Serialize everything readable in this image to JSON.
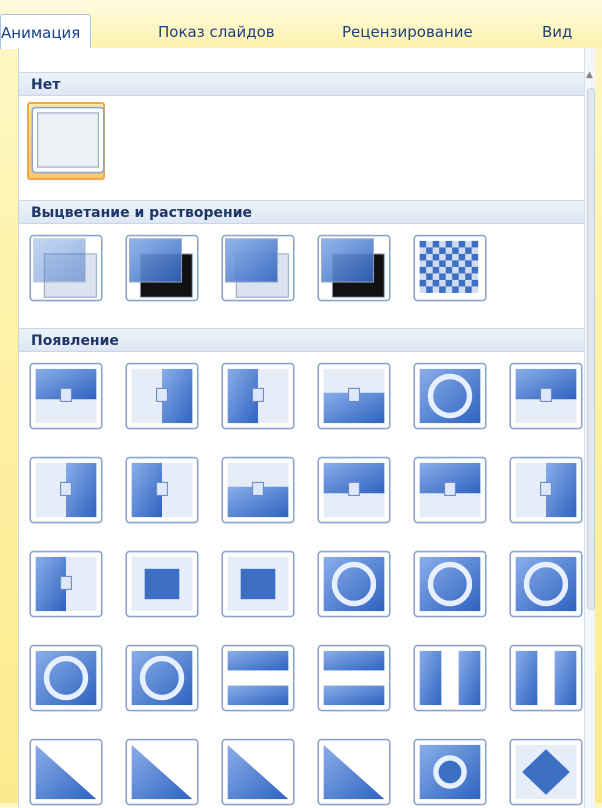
{
  "tabs": [
    {
      "label": "Анимация",
      "active": true
    },
    {
      "label": "Показ слайдов",
      "active": false
    },
    {
      "label": "Рецензирование",
      "active": false
    },
    {
      "label": "Вид",
      "active": false
    }
  ],
  "sections": {
    "none": "Нет",
    "fade": "Выцветание и растворение",
    "appear": "Появление"
  },
  "colors": {
    "accent": "#3d6fc4",
    "selection": "#ffc865",
    "section_bg": "#dde7f4"
  },
  "transitions": {
    "none": [
      "blank"
    ],
    "fade": [
      "fade-smoothly",
      "fade-through-black",
      "dissolve-light",
      "dissolve-dark",
      "checker-dissolve"
    ],
    "appear": [
      "cover-down",
      "cover-left",
      "cover-right",
      "cover-up",
      "wheel-clockwise",
      "push-down",
      "push-left",
      "push-right",
      "push-up",
      "cover-left-down",
      "cover-right-down",
      "cover-left-up",
      "cover-right-up",
      "box-in",
      "box-out",
      "wheel-2-spokes",
      "wheel-3-spokes",
      "wheel-4-spokes",
      "wheel-8-spokes",
      "wheel-8-spokes-alt",
      "split-horizontal-in",
      "split-horizontal-out",
      "split-vertical-in",
      "split-vertical-out",
      "strips-left-down",
      "strips-left-up",
      "strips-right-down",
      "strips-right-up",
      "circle",
      "diamond"
    ]
  }
}
